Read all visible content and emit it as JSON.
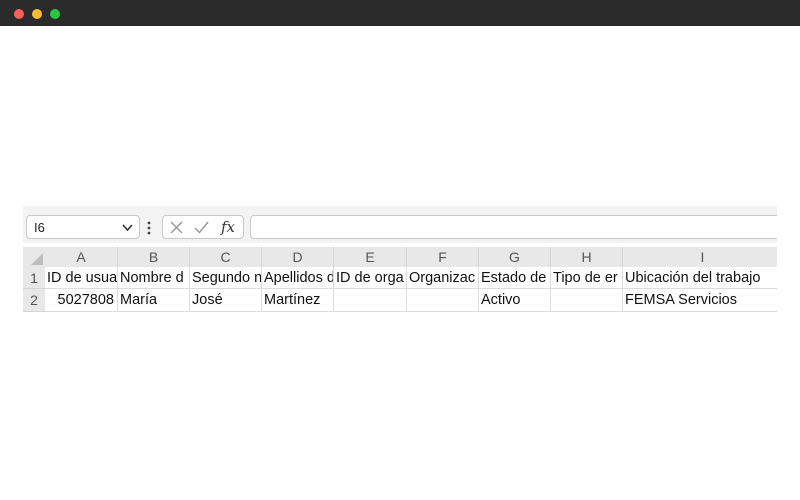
{
  "window": {
    "controls": [
      "close",
      "minimize",
      "maximize"
    ]
  },
  "formula_bar": {
    "name_box": "I6",
    "fx_label": "fx",
    "formula": ""
  },
  "grid": {
    "columns": [
      "A",
      "B",
      "C",
      "D",
      "E",
      "F",
      "G",
      "H",
      "I"
    ],
    "rows": [
      {
        "num": "1",
        "cells": [
          "ID de usua",
          "Nombre d",
          "Segundo n",
          "Apellidos d",
          "ID de orga",
          "Organizac",
          "Estado de",
          "Tipo de er",
          "Ubicación del trabajo"
        ]
      },
      {
        "num": "2",
        "cells": [
          "5027808",
          "María",
          "José",
          "Martínez",
          "",
          "",
          "Activo",
          "",
          "FEMSA Servicios"
        ]
      }
    ]
  },
  "colors": {
    "titlebar": "#2b2b2b",
    "header_fill": "#e8e8e8",
    "toolbar_fill": "#f3f3f3"
  }
}
